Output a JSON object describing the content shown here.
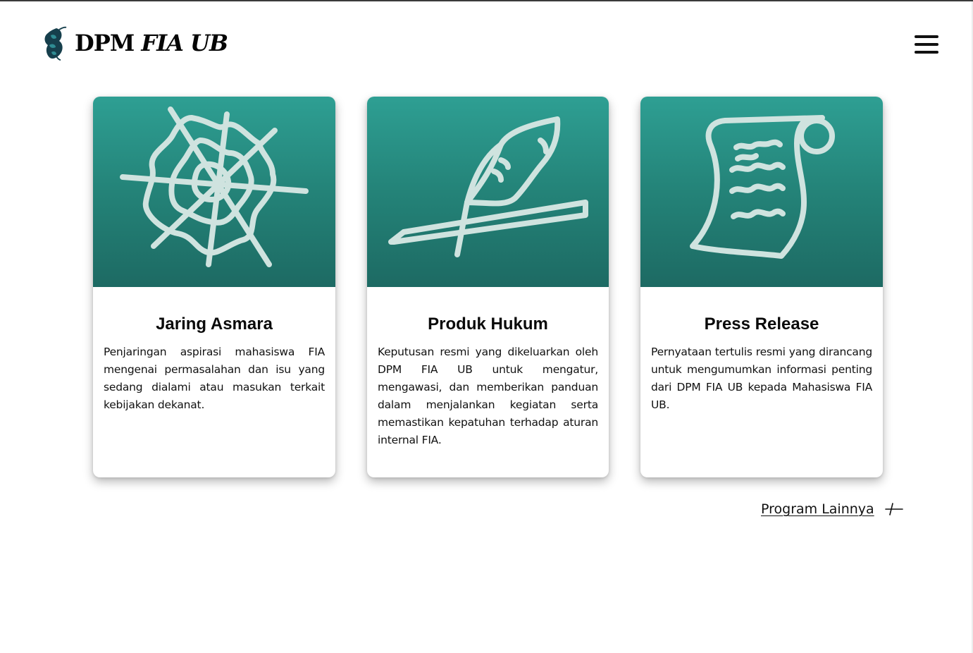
{
  "header": {
    "brand_prefix": "DPM ",
    "brand_italic": "FIA UB",
    "logo_icon": "peacock-feather-logo",
    "menu_icon": "hamburger-menu-icon"
  },
  "colors": {
    "accent_teal": "#2a9a8e",
    "accent_teal_dark": "#1d6a63",
    "icon_stroke": "#cfe3df"
  },
  "cards": [
    {
      "icon": "spider-web-icon",
      "title": "Jaring Asmara",
      "description": "Penjaringan aspirasi mahasiswa FIA mengenai permasalahan dan isu yang sedang dialami atau masukan terkait kebijakan dekanat."
    },
    {
      "icon": "quill-pen-icon",
      "title": "Produk Hukum",
      "description": "Keputusan resmi yang dikeluarkan oleh DPM FIA UB untuk mengatur, mengawasi, dan memberikan panduan dalam menjalankan kegiatan serta memastikan kepatuhan terhadap aturan internal FIA."
    },
    {
      "icon": "scroll-document-icon",
      "title": "Press Release",
      "description": "Pernyataan tertulis resmi yang dirancang untuk mengumumkan informasi penting dari DPM FIA UB kepada Mahasiswa FIA UB."
    }
  ],
  "more_link": {
    "label": "Program Lainnya",
    "icon": "arrow-right-icon"
  }
}
